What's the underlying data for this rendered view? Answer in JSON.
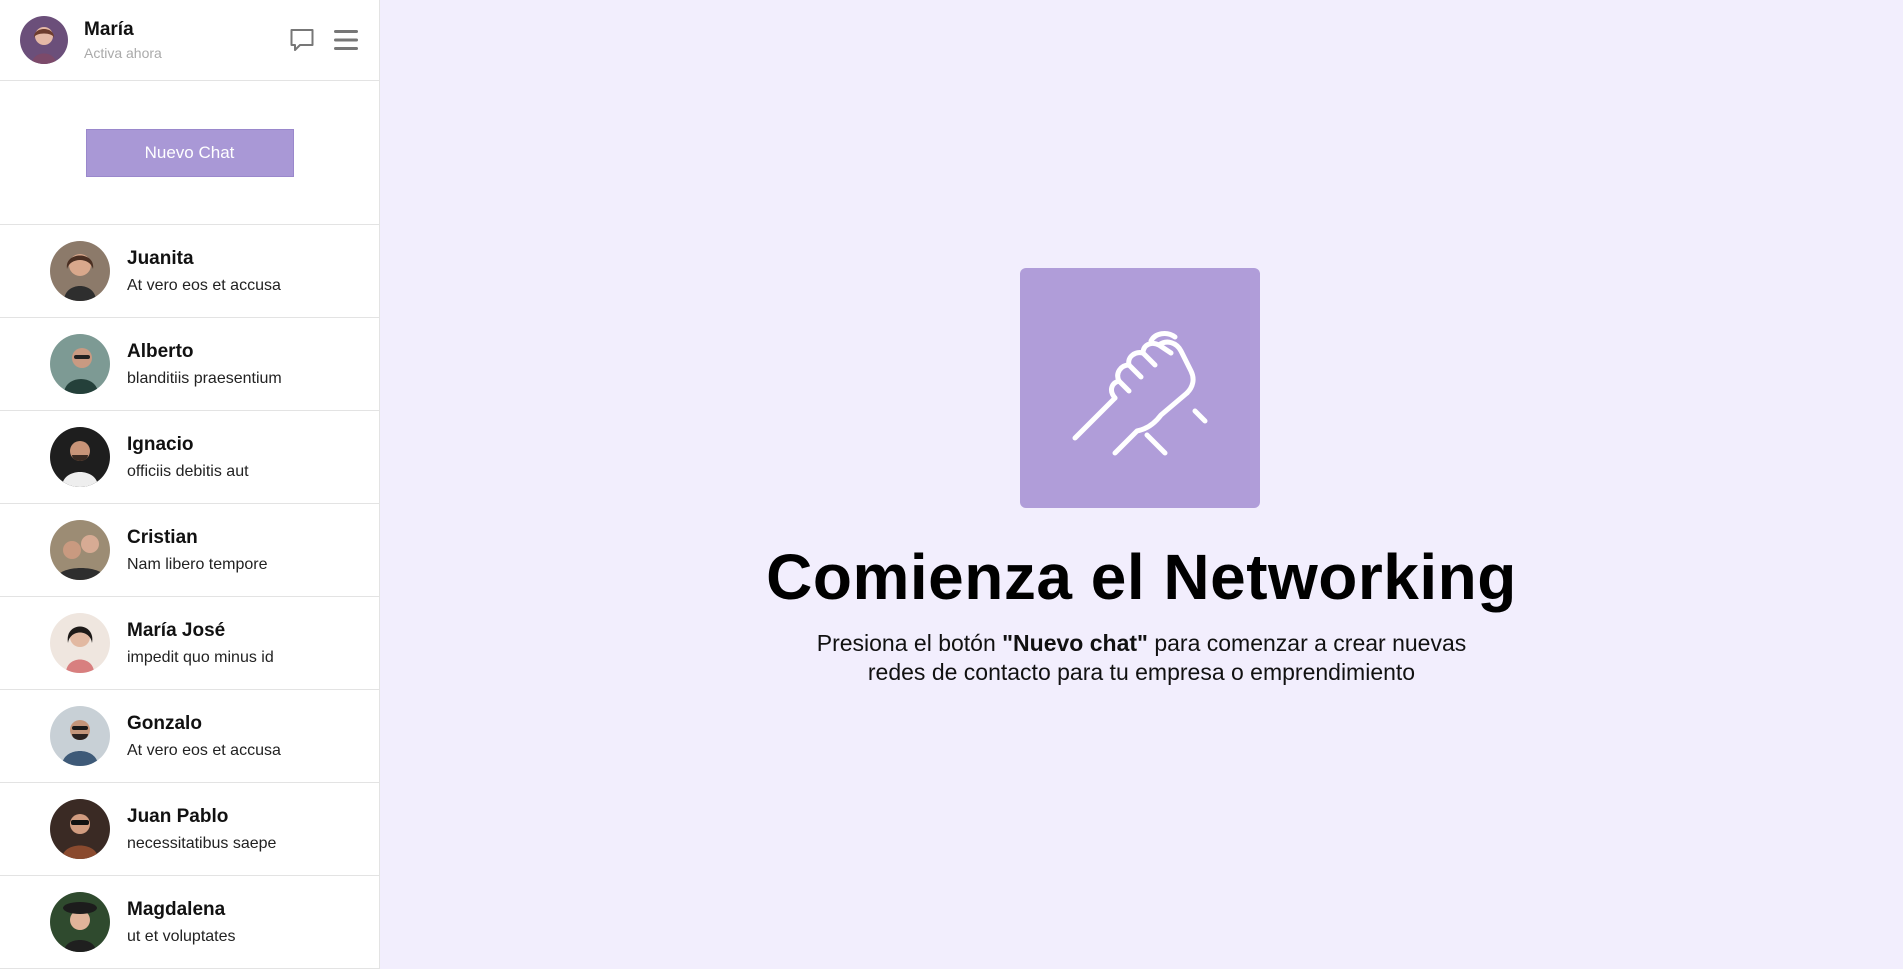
{
  "profile": {
    "name": "María",
    "status": "Activa ahora",
    "avatar_icon": "user-avatar",
    "actions": [
      {
        "icon": "chat-bubble-icon"
      },
      {
        "icon": "menu-icon"
      }
    ]
  },
  "new_chat": {
    "label": "Nuevo Chat"
  },
  "contacts": [
    {
      "name": "Juanita",
      "message": "At vero eos et accusa",
      "color": "#7a5a4c"
    },
    {
      "name": "Alberto",
      "message": "blanditiis praesentium",
      "color": "#3e5a52"
    },
    {
      "name": "Ignacio",
      "message": "officiis debitis aut",
      "color": "#2b2b2b"
    },
    {
      "name": "Cristian",
      "message": "Nam libero tempore",
      "color": "#8a6a58"
    },
    {
      "name": "María José",
      "message": "impedit quo minus id",
      "color": "#c9b3a8"
    },
    {
      "name": "Gonzalo",
      "message": "At vero eos et accusa",
      "color": "#5a6a7a"
    },
    {
      "name": "Juan Pablo",
      "message": "necessitatibus saepe",
      "color": "#4a3a34"
    },
    {
      "name": "Magdalena",
      "message": "ut et voluptates",
      "color": "#2f4a2e"
    }
  ],
  "hero": {
    "icon": "handshake-icon",
    "title": "Comienza el Networking",
    "subtitle_before": "Presiona el botón ",
    "subtitle_bold": "\"Nuevo chat\"",
    "subtitle_after": " para comenzar a crear nuevas",
    "subtitle_line2": "redes de contacto para tu empresa o emprendimiento"
  },
  "colors": {
    "accent": "#a998d6",
    "hero_tile": "#b09dd9",
    "main_bg": "#f2eefd"
  }
}
